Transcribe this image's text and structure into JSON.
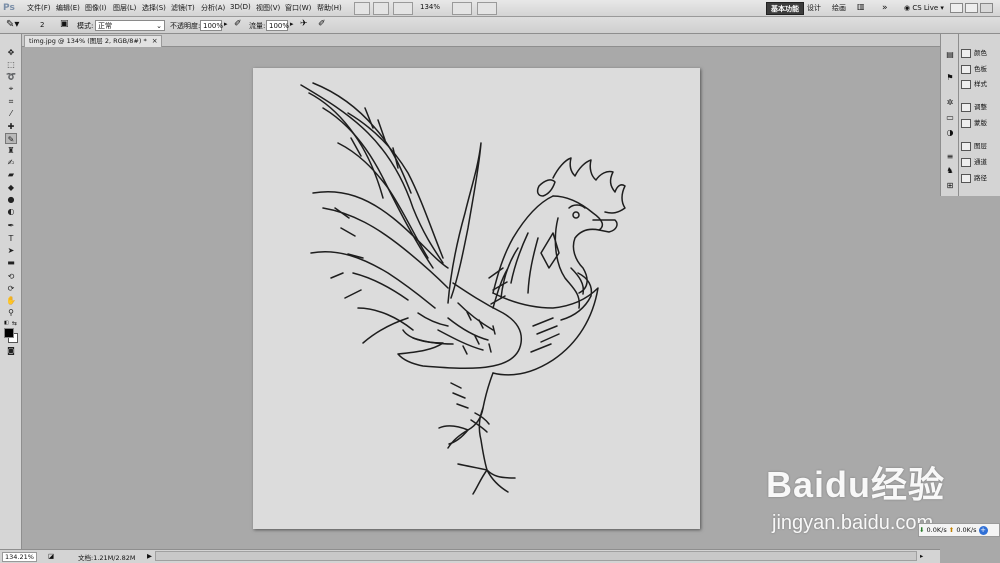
{
  "app": {
    "logo": "Ps"
  },
  "menus": [
    "文件(F)",
    "编辑(E)",
    "图像(I)",
    "图层(L)",
    "选择(S)",
    "滤镜(T)",
    "分析(A)",
    "3D(D)",
    "视图(V)",
    "窗口(W)",
    "帮助(H)"
  ],
  "menubar": {
    "zoom": "134%",
    "cs_live": "CS Live"
  },
  "workspaces": [
    "基本功能",
    "设计",
    "绘画"
  ],
  "options": {
    "brush_size": "2",
    "mode_label": "模式:",
    "mode_value": "正常",
    "opacity_label": "不透明度:",
    "opacity_value": "100%",
    "flow_label": "流量:",
    "flow_value": "100%"
  },
  "document": {
    "tab_title": "timg.jpg @ 134% (图层 2, RGB/8#) *",
    "close": "×"
  },
  "status": {
    "zoom": "134.21%",
    "doc_info": "文档:1.21M/2.82M"
  },
  "panels": [
    "颜色",
    "色板",
    "样式",
    "调整",
    "蒙版",
    "图层",
    "通道",
    "路径"
  ],
  "network": {
    "down": "0.0K/s",
    "up": "0.0K/s"
  },
  "watermark": {
    "brand": "Baidu经验",
    "url": "jingyan.baidu.com"
  },
  "colors": {
    "accent_dark": "#3c3c3c",
    "canvas_bg": "#a9a9a9",
    "image_bg": "#dcdcdc"
  }
}
